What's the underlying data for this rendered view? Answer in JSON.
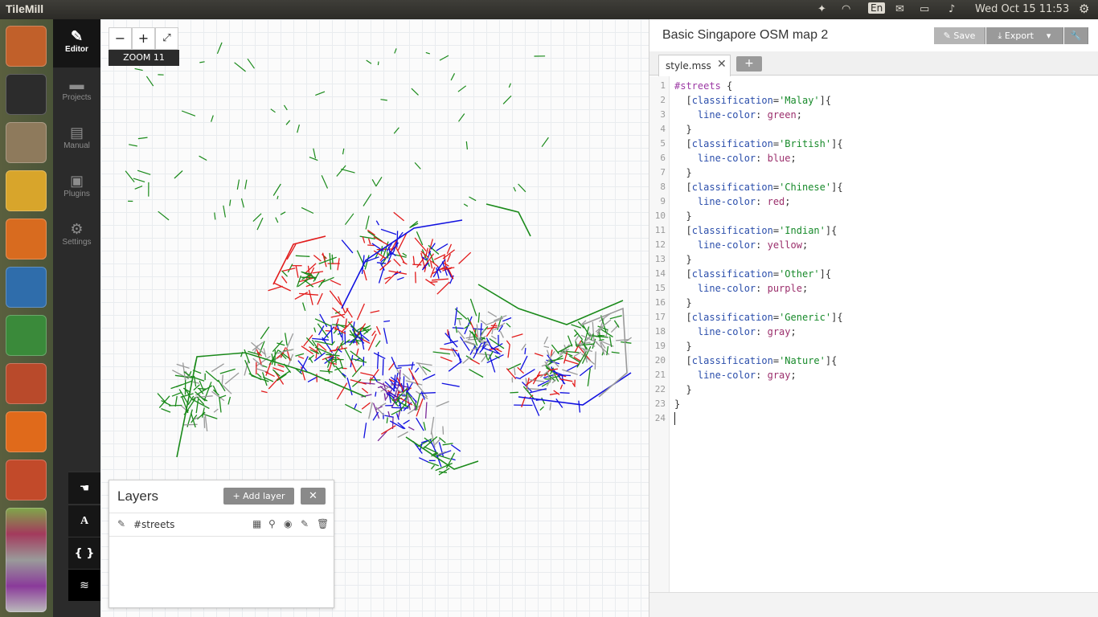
{
  "system": {
    "app_name": "TileMill",
    "keyboard_layout": "En",
    "clock": "Wed Oct 15 11:53"
  },
  "launcher": {
    "apps": [
      {
        "name": "ubuntu-dash",
        "color": "#c1602a"
      },
      {
        "name": "terminal",
        "color": "#2c2c2c"
      },
      {
        "name": "files",
        "color": "#8e7a5c"
      },
      {
        "name": "chrome",
        "color": "#d8a52b"
      },
      {
        "name": "firefox",
        "color": "#d86b1f"
      },
      {
        "name": "libreoffice-writer",
        "color": "#2f6dab"
      },
      {
        "name": "libreoffice-calc",
        "color": "#3a8a3a"
      },
      {
        "name": "libreoffice-impress",
        "color": "#b94a2b"
      },
      {
        "name": "software-center",
        "color": "#e06a1b"
      },
      {
        "name": "system-settings",
        "color": "#c24a2a"
      }
    ]
  },
  "sidenav": {
    "items": [
      {
        "label": "Editor",
        "icon": "pencil-icon"
      },
      {
        "label": "Projects",
        "icon": "folder-icon"
      },
      {
        "label": "Manual",
        "icon": "book-icon"
      },
      {
        "label": "Plugins",
        "icon": "plug-icon"
      },
      {
        "label": "Settings",
        "icon": "gear-icon"
      }
    ]
  },
  "tools": {
    "hand": "pan-hand-icon",
    "fonts": "A",
    "carto": "{ }",
    "layers": "layers-icon"
  },
  "map": {
    "zoom_label": "ZOOM 11",
    "zoom_out": "−",
    "zoom_in": "+",
    "fullscreen": "⤢",
    "line_colors": [
      "green",
      "blue",
      "red",
      "yellow",
      "purple",
      "gray"
    ]
  },
  "layers_panel": {
    "title": "Layers",
    "add_layer": "Add layer",
    "layer_name": "#streets"
  },
  "project": {
    "title": "Basic Singapore OSM map 2",
    "save": "Save",
    "export": "Export"
  },
  "editor": {
    "tab": "style.mss",
    "line_numbers": [
      "1",
      "2",
      "3",
      "4",
      "5",
      "6",
      "7",
      "8",
      "9",
      "10",
      "11",
      "12",
      "13",
      "14",
      "15",
      "16",
      "17",
      "18",
      "19",
      "20",
      "21",
      "22",
      "23",
      "24"
    ],
    "lines": [
      "#streets {",
      "  [classification='Malay']{",
      "    line-color: green;",
      "  }",
      "  [classification='British']{",
      "    line-color: blue;",
      "  }",
      "  [classification='Chinese']{",
      "    line-color: red;",
      "  }",
      "  [classification='Indian']{",
      "    line-color: yellow;",
      "  }",
      "  [classification='Other']{",
      "    line-color: purple;",
      "  }",
      "  [classification='Generic']{",
      "    line-color: gray;",
      "  }",
      "  [classification='Nature']{",
      "    line-color: gray;",
      "  }",
      "}",
      ""
    ]
  }
}
